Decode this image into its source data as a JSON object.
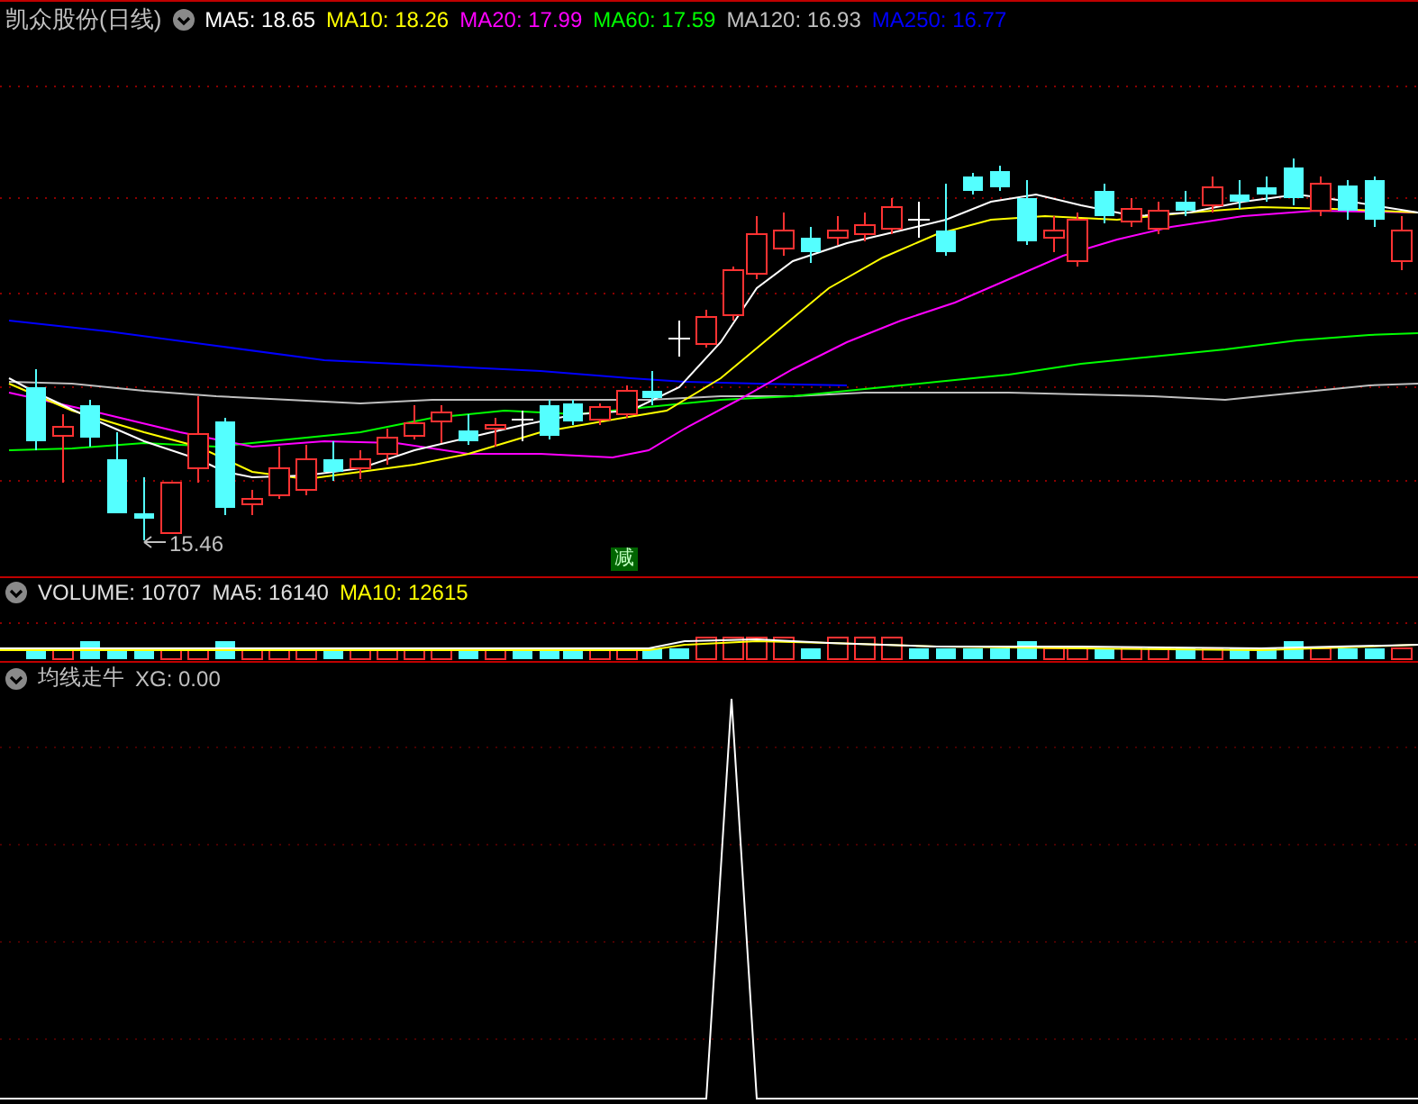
{
  "main_panel": {
    "title": "凯众股份(日线)",
    "indicators": [
      {
        "label": "MA5: 18.65",
        "color": "#ffffff"
      },
      {
        "label": "MA10: 18.26",
        "color": "#ffff00"
      },
      {
        "label": "MA20: 17.99",
        "color": "#ff00ff"
      },
      {
        "label": "MA60: 17.59",
        "color": "#00ff00"
      },
      {
        "label": "MA120: 16.93",
        "color": "#c0c0c0"
      },
      {
        "label": "MA250: 16.77",
        "color": "#0000ff"
      }
    ],
    "low_label": "15.46",
    "signal_badge": "减"
  },
  "volume_panel": {
    "indicators": [
      {
        "label": "VOLUME: 10707",
        "color": "#e0e0e0"
      },
      {
        "label": "MA5: 16140",
        "color": "#e0e0e0"
      },
      {
        "label": "MA10: 12615",
        "color": "#ffff00"
      }
    ]
  },
  "signal_panel": {
    "indicators": [
      {
        "label": "均线走牛",
        "color": "#c0c0c0"
      },
      {
        "label": "XG: 0.00",
        "color": "#c0c0c0"
      }
    ]
  }
}
